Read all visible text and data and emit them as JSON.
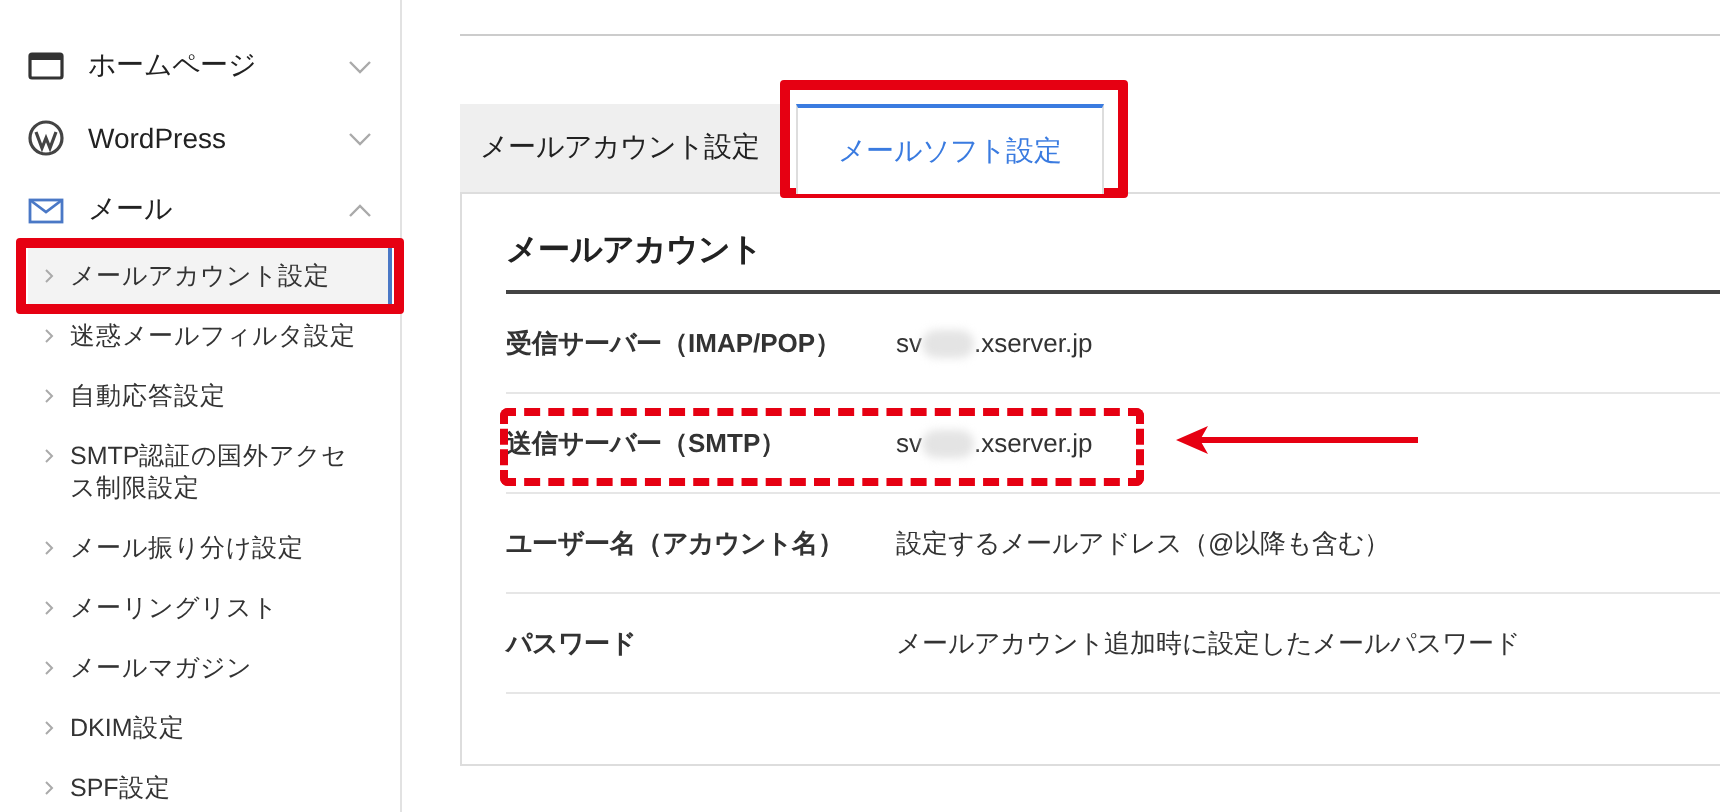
{
  "sidebar": {
    "items": [
      {
        "label": "ホームページ",
        "expanded": false
      },
      {
        "label": "WordPress",
        "expanded": false
      },
      {
        "label": "メール",
        "expanded": true,
        "children": [
          {
            "label": "メールアカウント設定",
            "selected": true,
            "highlighted": true
          },
          {
            "label": "迷惑メールフィルタ設定",
            "selected": false,
            "highlighted": false
          },
          {
            "label": "自動応答設定",
            "selected": false,
            "highlighted": false
          },
          {
            "label": "SMTP認証の国外アクセス制限設定",
            "selected": false,
            "highlighted": false
          },
          {
            "label": "メール振り分け設定",
            "selected": false,
            "highlighted": false
          },
          {
            "label": "メーリングリスト",
            "selected": false,
            "highlighted": false
          },
          {
            "label": "メールマガジン",
            "selected": false,
            "highlighted": false
          },
          {
            "label": "DKIM設定",
            "selected": false,
            "highlighted": false
          },
          {
            "label": "SPF設定",
            "selected": false,
            "highlighted": false
          }
        ]
      }
    ]
  },
  "tabs": [
    {
      "label": "メールアカウント設定",
      "selected": false,
      "highlighted": false
    },
    {
      "label": "メールソフト設定",
      "selected": true,
      "highlighted": true
    }
  ],
  "section": {
    "heading": "メールアカウント",
    "rows": [
      {
        "label": "受信サーバー（IMAP/POP）",
        "value": "sv",
        "value_suffix": ".xserver.jp",
        "redacted": true,
        "highlighted": false,
        "arrow": false
      },
      {
        "label": "送信サーバー（SMTP）",
        "value": "sv",
        "value_suffix": ".xserver.jp",
        "redacted": true,
        "highlighted": true,
        "arrow": true
      },
      {
        "label": "ユーザー名（アカウント名）",
        "value": "設定するメールアドレス（@以降も含む）",
        "redacted": false,
        "highlighted": false,
        "arrow": false
      },
      {
        "label": "パスワード",
        "value": "メールアカウント追加時に設定したメールパスワード",
        "redacted": false,
        "highlighted": false,
        "arrow": false
      }
    ]
  }
}
